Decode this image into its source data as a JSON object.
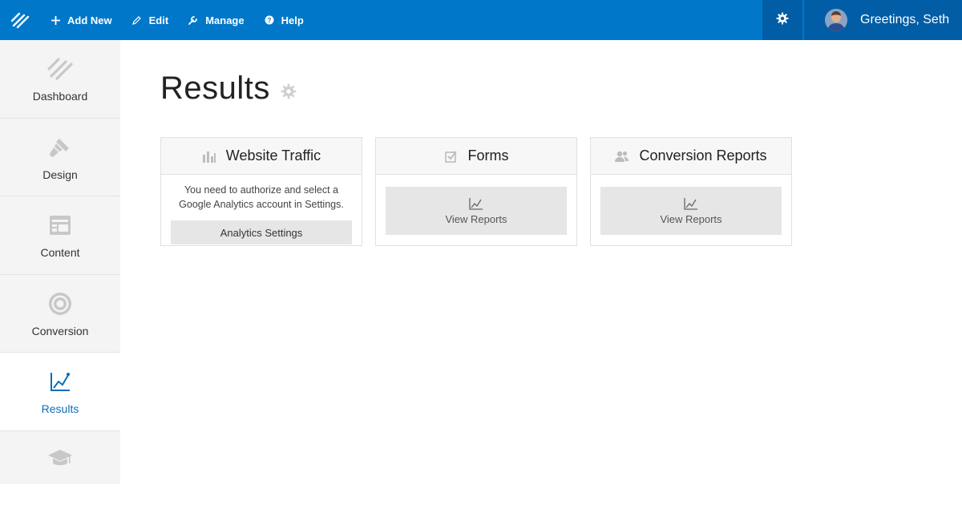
{
  "topbar": {
    "add_new": "Add New",
    "edit": "Edit",
    "manage": "Manage",
    "help": "Help",
    "greeting": "Greetings, Seth"
  },
  "sidebar": {
    "items": [
      {
        "label": "Dashboard",
        "icon": "logo-stripes-icon"
      },
      {
        "label": "Design",
        "icon": "paint-brush-icon"
      },
      {
        "label": "Content",
        "icon": "layout-icon"
      },
      {
        "label": "Conversion",
        "icon": "target-icon"
      },
      {
        "label": "Results",
        "icon": "chart-line-icon",
        "active": true
      },
      {
        "label": "",
        "icon": "graduation-cap-icon"
      }
    ]
  },
  "main": {
    "title": "Results",
    "cards": [
      {
        "title": "Website Traffic",
        "icon": "bar-chart-icon",
        "message": "You need to authorize and select a Google Analytics account in Settings.",
        "button": "Analytics Settings"
      },
      {
        "title": "Forms",
        "icon": "checkbox-icon",
        "button": "View Reports"
      },
      {
        "title": "Conversion Reports",
        "icon": "users-icon",
        "button": "View Reports"
      }
    ]
  },
  "colors": {
    "topbar": "#0077c8",
    "topbar_dark": "#005da6",
    "active_link": "#0b6db7"
  }
}
